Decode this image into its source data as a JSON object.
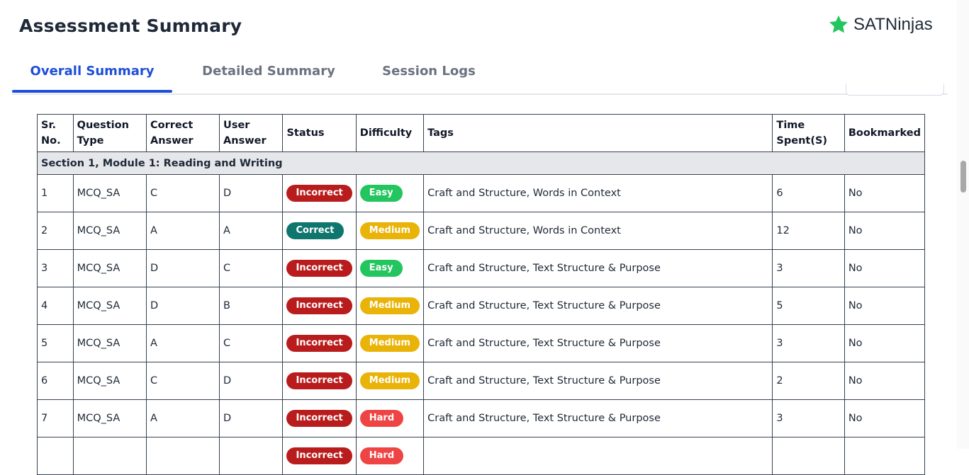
{
  "header": {
    "title": "Assessment Summary",
    "logo_text": "SATNinjas",
    "logo_color": "#22c55e"
  },
  "tabs": [
    {
      "label": "Overall Summary",
      "active": true
    },
    {
      "label": "Detailed Summary",
      "active": false
    },
    {
      "label": "Session Logs",
      "active": false
    }
  ],
  "table": {
    "headers": [
      "Sr. No.",
      "Question Type",
      "Correct Answer",
      "User Answer",
      "Status",
      "Difficulty",
      "Tags",
      "Time Spent(S)",
      "Bookmarked"
    ],
    "section": "Section 1, Module 1: Reading and Writing",
    "rows": [
      {
        "sr": "1",
        "type": "MCQ_SA",
        "correct": "C",
        "user": "D",
        "status": "Incorrect",
        "difficulty": "Easy",
        "tags": "Craft and Structure, Words in Context",
        "time": "6",
        "bookmarked": "No"
      },
      {
        "sr": "2",
        "type": "MCQ_SA",
        "correct": "A",
        "user": "A",
        "status": "Correct",
        "difficulty": "Medium",
        "tags": "Craft and Structure, Words in Context",
        "time": "12",
        "bookmarked": "No"
      },
      {
        "sr": "3",
        "type": "MCQ_SA",
        "correct": "D",
        "user": "C",
        "status": "Incorrect",
        "difficulty": "Easy",
        "tags": "Craft and Structure, Text Structure & Purpose",
        "time": "3",
        "bookmarked": "No"
      },
      {
        "sr": "4",
        "type": "MCQ_SA",
        "correct": "D",
        "user": "B",
        "status": "Incorrect",
        "difficulty": "Medium",
        "tags": "Craft and Structure, Text Structure & Purpose",
        "time": "5",
        "bookmarked": "No"
      },
      {
        "sr": "5",
        "type": "MCQ_SA",
        "correct": "A",
        "user": "C",
        "status": "Incorrect",
        "difficulty": "Medium",
        "tags": "Craft and Structure, Text Structure & Purpose",
        "time": "3",
        "bookmarked": "No"
      },
      {
        "sr": "6",
        "type": "MCQ_SA",
        "correct": "C",
        "user": "D",
        "status": "Incorrect",
        "difficulty": "Medium",
        "tags": "Craft and Structure, Text Structure & Purpose",
        "time": "2",
        "bookmarked": "No"
      },
      {
        "sr": "7",
        "type": "MCQ_SA",
        "correct": "A",
        "user": "D",
        "status": "Incorrect",
        "difficulty": "Hard",
        "tags": "Craft and Structure, Text Structure & Purpose",
        "time": "3",
        "bookmarked": "No"
      },
      {
        "sr": "",
        "type": "",
        "correct": "",
        "user": "",
        "status": "Incorrect",
        "difficulty": "Hard",
        "tags": "",
        "time": "",
        "bookmarked": ""
      }
    ]
  },
  "colors": {
    "status": {
      "Incorrect": "#b91c1c",
      "Correct": "#0f766e"
    },
    "difficulty": {
      "Easy": "#22c55e",
      "Medium": "#eab308",
      "Hard": "#ef4444"
    }
  }
}
